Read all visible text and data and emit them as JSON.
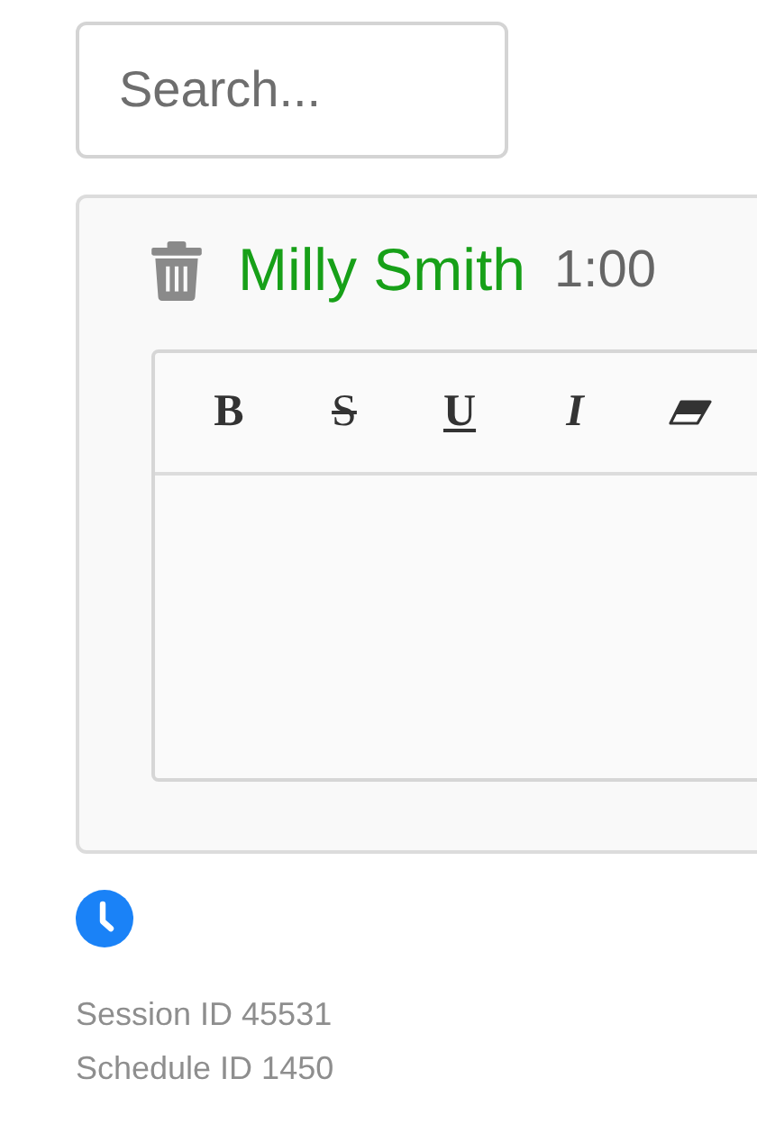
{
  "search": {
    "placeholder": "Search..."
  },
  "entry": {
    "name": "Milly Smith",
    "duration": "1:00"
  },
  "toolbar": [
    {
      "kind": "bold",
      "label": "B"
    },
    {
      "kind": "strike",
      "label": "S"
    },
    {
      "kind": "underline",
      "label": "U"
    },
    {
      "kind": "italic",
      "label": "I"
    },
    {
      "kind": "eraser"
    }
  ],
  "footer": [
    "Session ID 45531",
    "Schedule ID 1450"
  ]
}
